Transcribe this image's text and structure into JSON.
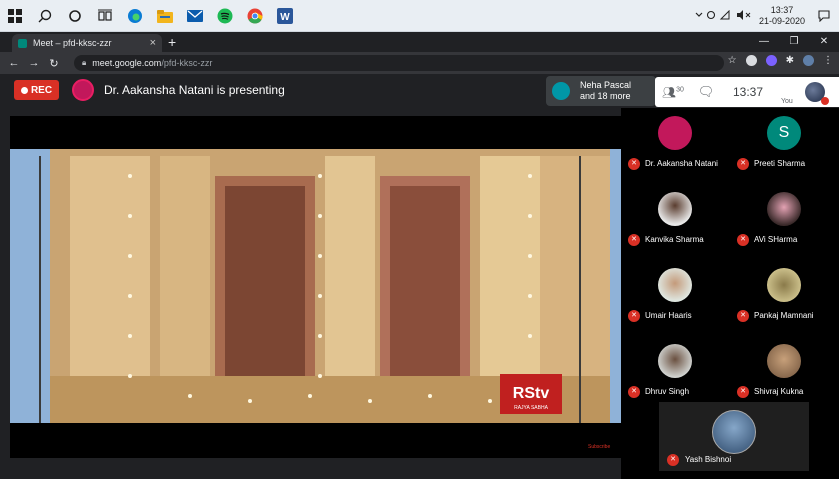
{
  "taskbar": {
    "apps": [
      {
        "name": "windows-start-icon",
        "color": "#1e1e1e"
      },
      {
        "name": "search-icon",
        "color": "#1e1e1e"
      },
      {
        "name": "cortana-icon",
        "color": "#1e1e1e"
      },
      {
        "name": "task-view-icon",
        "color": "#1e1e1e"
      },
      {
        "name": "edge-icon",
        "color": "#0a7cd4"
      },
      {
        "name": "file-explorer-icon",
        "color": "#f2b51d"
      },
      {
        "name": "mail-icon",
        "color": "#0b5cad"
      },
      {
        "name": "spotify-icon",
        "color": "#1db954"
      },
      {
        "name": "chrome-icon",
        "color": "#e94235"
      },
      {
        "name": "word-icon",
        "color": "#2b579a"
      }
    ],
    "time": "13:37",
    "date": "21-09-2020"
  },
  "browser": {
    "tab_title": "Meet – pfd-kksc-zzr",
    "url_host": "meet.google.com",
    "url_path": "/pfd-kksc-zzr"
  },
  "meet": {
    "rec_label": "REC",
    "presenting_text": "Dr. Aakansha Natani is presenting",
    "chip_line1": "Neha Pascal",
    "chip_line2": "and 18 more",
    "participant_count": "30",
    "clock": "13:37",
    "you_label": "You",
    "stage_logo": "RStv",
    "stage_logo_sub": "RAJYA SABHA",
    "subscribe": "Subscribe",
    "participants": [
      {
        "name": "Dr. Aakansha Natani",
        "avatar_color": "#c2185b"
      },
      {
        "name": "Preeti Sharma",
        "avatar_color": "#00897b",
        "letter": "S"
      },
      {
        "name": "Kanvika Sharma",
        "avatar_color": "#e8e8e8"
      },
      {
        "name": "AVi SHarma",
        "avatar_color": "#3a2a2a"
      },
      {
        "name": "Umair Haaris",
        "avatar_color": "#dfe7e1"
      },
      {
        "name": "Pankaj Mamnani",
        "avatar_color": "#cbbf8a"
      },
      {
        "name": "Dhruv Singh",
        "avatar_color": "#d0d2cf"
      },
      {
        "name": "Shivraj Kukna",
        "avatar_color": "#8a6a4e"
      },
      {
        "name": "Yash Bishnoi",
        "avatar_color": "#4f7aa8"
      }
    ]
  }
}
